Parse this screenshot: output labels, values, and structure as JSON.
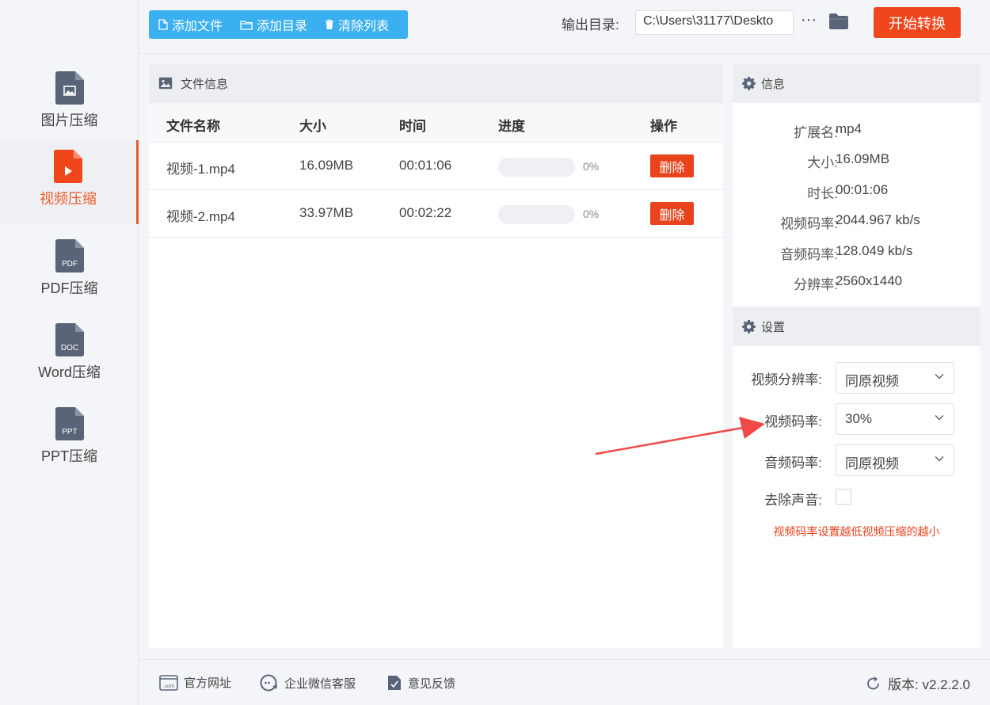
{
  "sidebar": {
    "items": [
      {
        "label": "图片压缩",
        "icon": "image-file-icon",
        "badge": ""
      },
      {
        "label": "视频压缩",
        "icon": "video-file-icon",
        "badge": ""
      },
      {
        "label": "PDF压缩",
        "icon": "pdf-file-icon",
        "badge": "PDF"
      },
      {
        "label": "Word压缩",
        "icon": "doc-file-icon",
        "badge": "DOC"
      },
      {
        "label": "PPT压缩",
        "icon": "ppt-file-icon",
        "badge": "PPT"
      }
    ],
    "active_index": 1
  },
  "toolbar": {
    "add_file": "添加文件",
    "add_folder": "添加目录",
    "clear_list": "清除列表",
    "output_label": "输出目录:",
    "output_path": "C:\\Users\\31177\\Deskto",
    "more": "···",
    "start": "开始转换"
  },
  "files": {
    "panel_title": "文件信息",
    "columns": [
      "文件名称",
      "大小",
      "时间",
      "进度",
      "操作"
    ],
    "rows": [
      {
        "name": "视频-1.mp4",
        "size": "16.09MB",
        "time": "00:01:06",
        "progress": 0,
        "progress_text": "0%",
        "action": "删除"
      },
      {
        "name": "视频-2.mp4",
        "size": "33.97MB",
        "time": "00:02:22",
        "progress": 0,
        "progress_text": "0%",
        "action": "删除"
      }
    ]
  },
  "info": {
    "title": "信息",
    "rows": [
      {
        "key": "扩展名:",
        "value": "mp4"
      },
      {
        "key": "大小:",
        "value": "16.09MB"
      },
      {
        "key": "时长:",
        "value": "00:01:06"
      },
      {
        "key": "视频码率:",
        "value": "2044.967 kb/s"
      },
      {
        "key": "音频码率:",
        "value": "128.049 kb/s"
      },
      {
        "key": "分辨率:",
        "value": "2560x1440"
      }
    ]
  },
  "settings": {
    "title": "设置",
    "video_resolution_label": "视频分辨率:",
    "video_resolution_value": "同原视频",
    "video_bitrate_label": "视频码率:",
    "video_bitrate_value": "30%",
    "audio_bitrate_label": "音频码率:",
    "audio_bitrate_value": "同原视频",
    "remove_audio_label": "去除声音:",
    "remove_audio_checked": false,
    "hint": "视频码率设置越低视频压缩的越小"
  },
  "footer": {
    "website": "官方网址",
    "wechat": "企业微信客服",
    "feedback": "意见反馈",
    "version": "版本: v2.2.2.0"
  },
  "colors": {
    "accent": "#f05a28",
    "primary": "#3ab0f0",
    "danger": "#e8431c",
    "icon_gray": "#5a6478"
  }
}
